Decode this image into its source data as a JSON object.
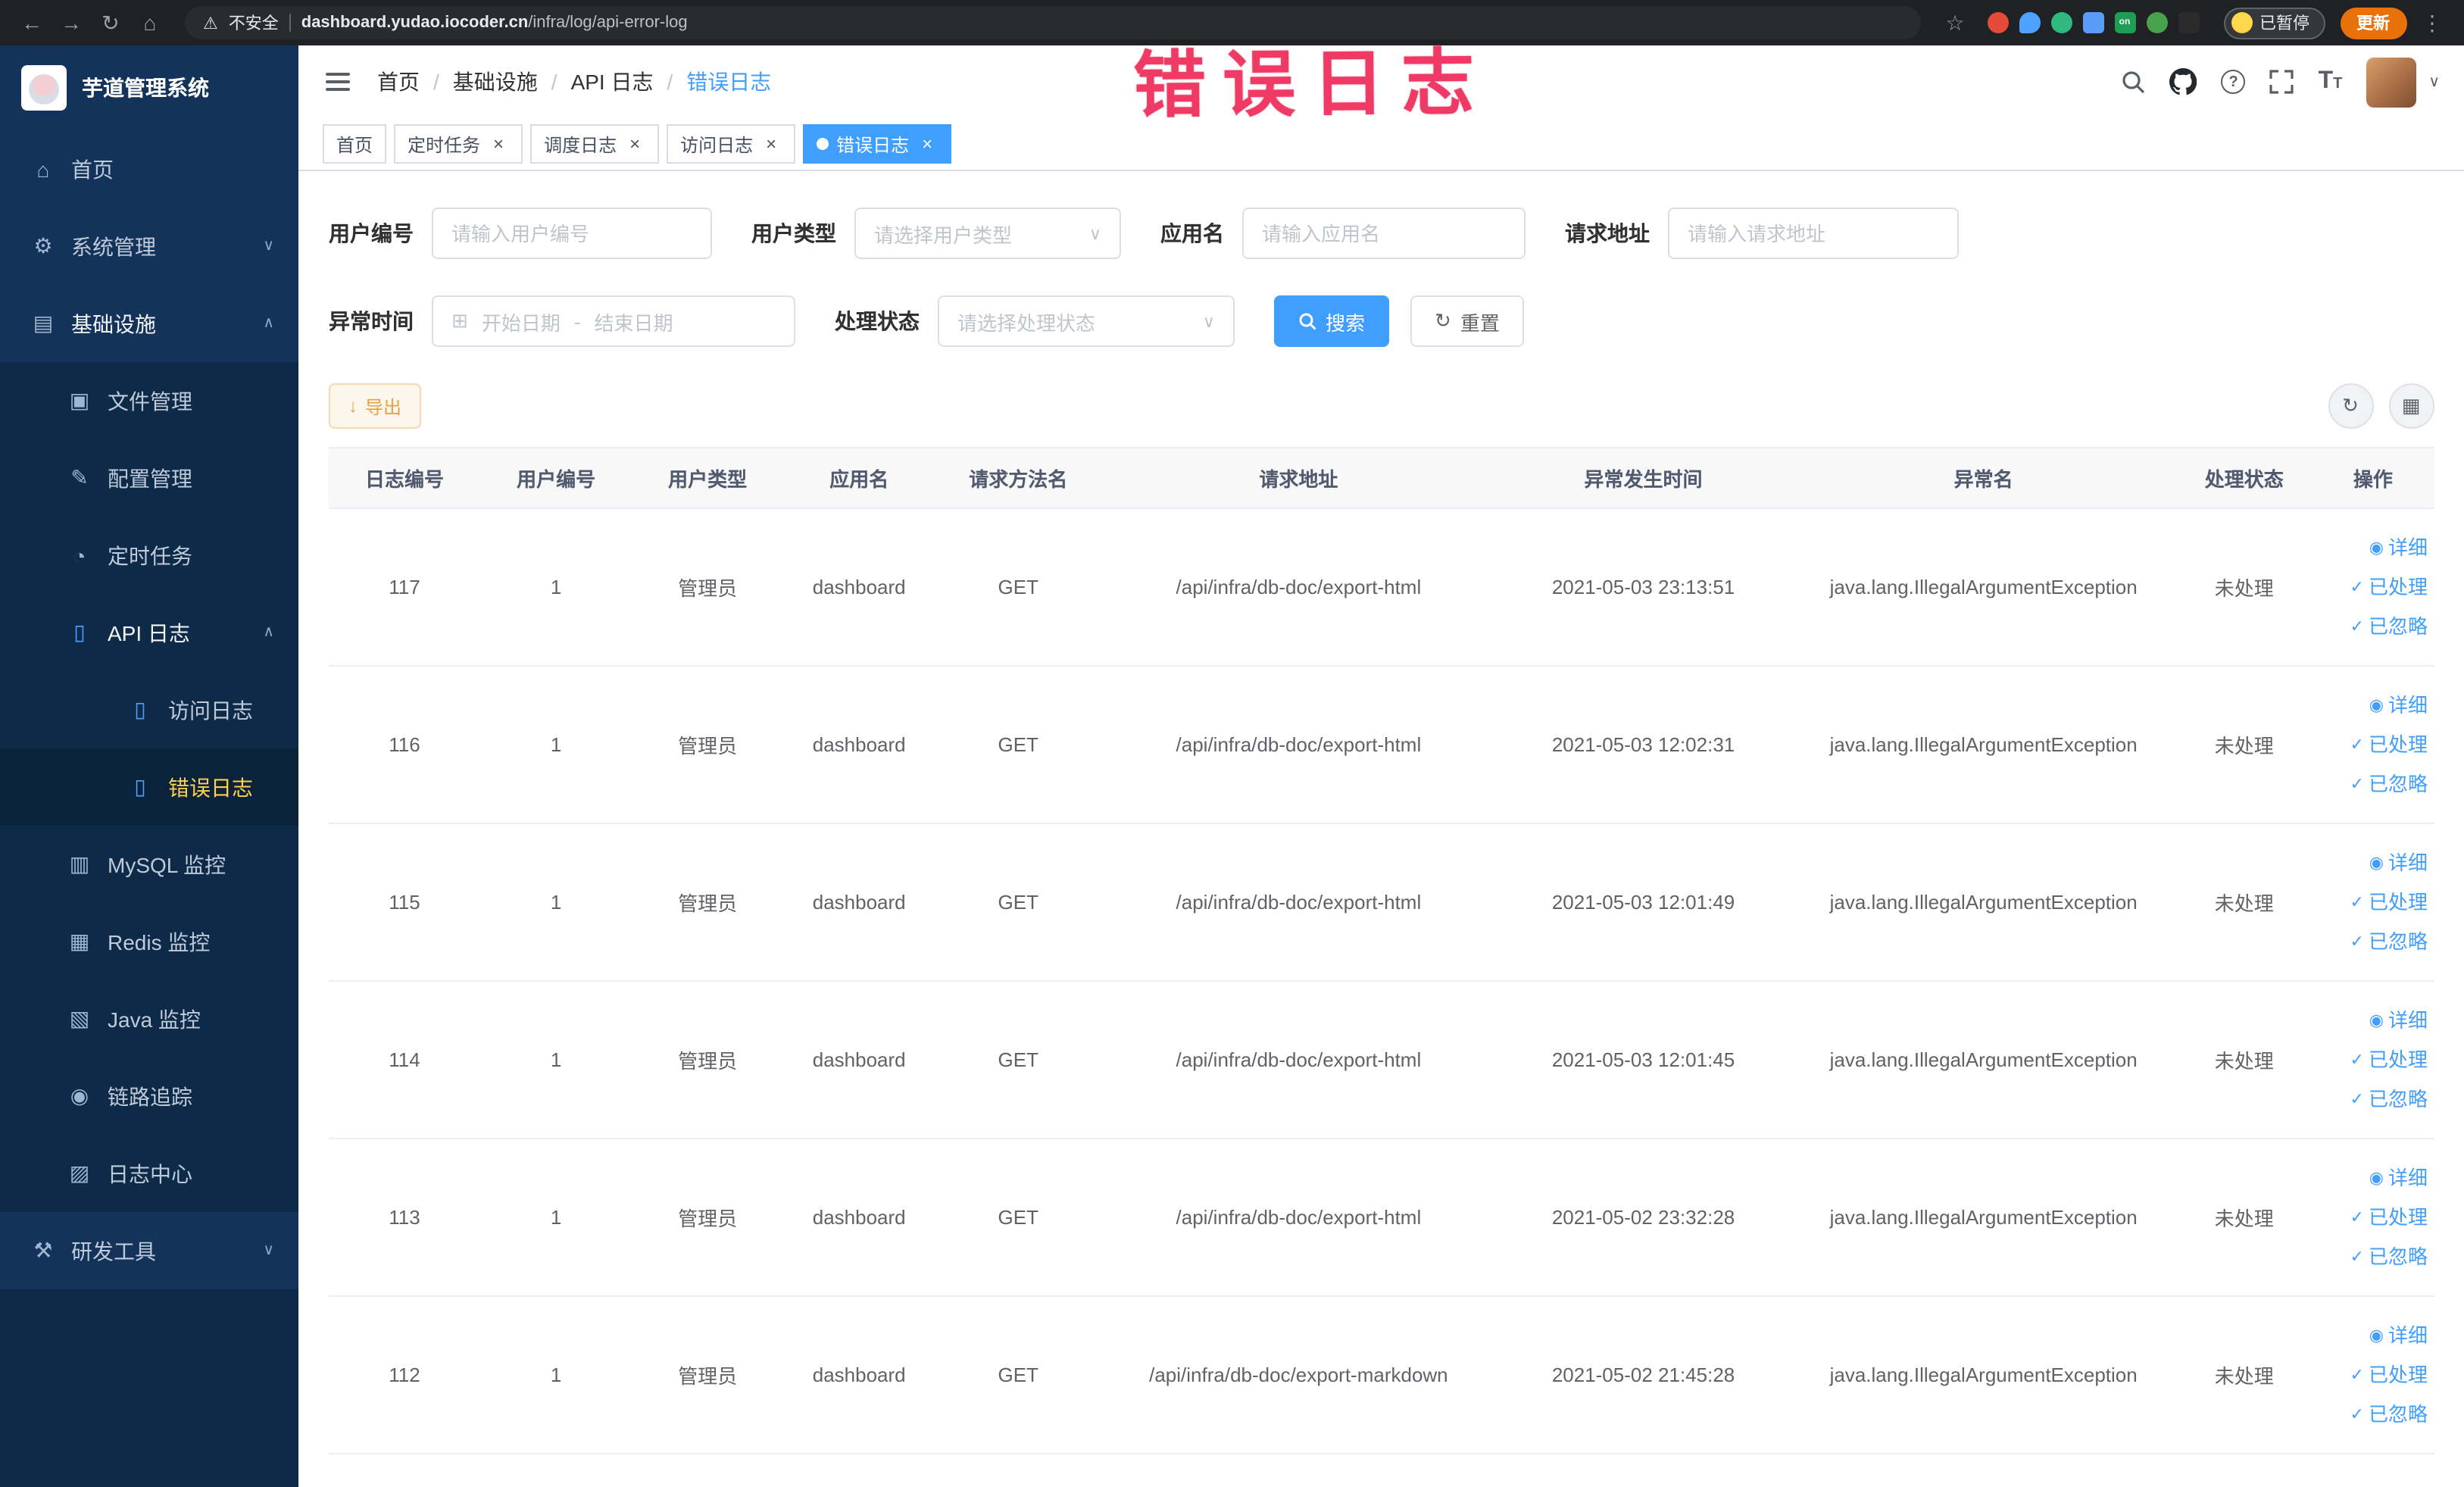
{
  "browser": {
    "security_label": "不安全",
    "url_domain": "dashboard.yudao.iocoder.cn",
    "url_path": "/infra/log/api-error-log",
    "paused_badge": "已暂停",
    "update_label": "更新",
    "extension_on_label": "on"
  },
  "annotation": "错误日志",
  "sidebar": {
    "title": "芋道管理系统",
    "items": [
      {
        "label": "首页"
      },
      {
        "label": "系统管理"
      },
      {
        "label": "基础设施"
      },
      {
        "label": "文件管理"
      },
      {
        "label": "配置管理"
      },
      {
        "label": "定时任务"
      },
      {
        "label": "API 日志"
      },
      {
        "label": "访问日志"
      },
      {
        "label": "错误日志"
      },
      {
        "label": "MySQL 监控"
      },
      {
        "label": "Redis 监控"
      },
      {
        "label": "Java 监控"
      },
      {
        "label": "链路追踪"
      },
      {
        "label": "日志中心"
      },
      {
        "label": "研发工具"
      }
    ]
  },
  "header": {
    "breadcrumb": [
      "首页",
      "基础设施",
      "API 日志",
      "错误日志"
    ]
  },
  "tabs": [
    {
      "label": "首页"
    },
    {
      "label": "定时任务"
    },
    {
      "label": "调度日志"
    },
    {
      "label": "访问日志"
    },
    {
      "label": "错误日志"
    }
  ],
  "filters": {
    "user_id_label": "用户编号",
    "user_id_placeholder": "请输入用户编号",
    "user_type_label": "用户类型",
    "user_type_placeholder": "请选择用户类型",
    "app_label": "应用名",
    "app_placeholder": "请输入应用名",
    "url_label": "请求地址",
    "url_placeholder": "请输入请求地址",
    "time_label": "异常时间",
    "time_start_placeholder": "开始日期",
    "time_separator": "-",
    "time_end_placeholder": "结束日期",
    "status_label": "处理状态",
    "status_placeholder": "请选择处理状态",
    "search_label": "搜索",
    "reset_label": "重置"
  },
  "toolbar": {
    "export_label": "导出"
  },
  "table": {
    "columns": [
      "日志编号",
      "用户编号",
      "用户类型",
      "应用名",
      "请求方法名",
      "请求地址",
      "异常发生时间",
      "异常名",
      "处理状态",
      "操作"
    ],
    "actions": [
      "详细",
      "已处理",
      "已忽略"
    ],
    "rows": [
      {
        "id": "117",
        "user_id": "1",
        "user_type": "管理员",
        "app": "dashboard",
        "method": "GET",
        "url": "/api/infra/db-doc/export-html",
        "time": "2021-05-03 23:13:51",
        "exception": "java.lang.IllegalArgumentException",
        "status": "未处理"
      },
      {
        "id": "116",
        "user_id": "1",
        "user_type": "管理员",
        "app": "dashboard",
        "method": "GET",
        "url": "/api/infra/db-doc/export-html",
        "time": "2021-05-03 12:02:31",
        "exception": "java.lang.IllegalArgumentException",
        "status": "未处理"
      },
      {
        "id": "115",
        "user_id": "1",
        "user_type": "管理员",
        "app": "dashboard",
        "method": "GET",
        "url": "/api/infra/db-doc/export-html",
        "time": "2021-05-03 12:01:49",
        "exception": "java.lang.IllegalArgumentException",
        "status": "未处理"
      },
      {
        "id": "114",
        "user_id": "1",
        "user_type": "管理员",
        "app": "dashboard",
        "method": "GET",
        "url": "/api/infra/db-doc/export-html",
        "time": "2021-05-03 12:01:45",
        "exception": "java.lang.IllegalArgumentException",
        "status": "未处理"
      },
      {
        "id": "113",
        "user_id": "1",
        "user_type": "管理员",
        "app": "dashboard",
        "method": "GET",
        "url": "/api/infra/db-doc/export-html",
        "time": "2021-05-02 23:32:28",
        "exception": "java.lang.IllegalArgumentException",
        "status": "未处理"
      },
      {
        "id": "112",
        "user_id": "1",
        "user_type": "管理员",
        "app": "dashboard",
        "method": "GET",
        "url": "/api/infra/db-doc/export-markdown",
        "time": "2021-05-02 21:45:28",
        "exception": "java.lang.IllegalArgumentException",
        "status": "未处理"
      }
    ]
  },
  "icons": {
    "back": "←",
    "forward": "→",
    "reload": "↻",
    "home": "⌂",
    "warning": "⚠",
    "star": "☆",
    "dots": "⋮",
    "gear": "⚙",
    "grid": "▤",
    "file": "▣",
    "edit": "✎",
    "clock": "◔",
    "doc": "▯",
    "monitor": "▥",
    "box": "▦",
    "java": "▧",
    "eye": "◉",
    "logcenter": "▨",
    "tools": "⚒",
    "chev_down": "∨",
    "chev_up": "∧",
    "close": "×",
    "check": "✓",
    "detail_eye": "◉",
    "refresh": "↻",
    "columns": "▦",
    "download": "↓",
    "calendar": "⊞",
    "caret": "∨",
    "slash": "/",
    "question": "?",
    "font_big": "T",
    "font_small": "T"
  },
  "colors": {
    "accent": "#409eff",
    "sidebar_bg": "#14335a",
    "sidebar_submenu_bg": "#0e2a49",
    "sidebar_active_text": "#ffd04b",
    "warning": "#e6a23c",
    "annotation": "#ee3a64",
    "chrome_bg": "#202124",
    "update_button": "#e8710a"
  }
}
